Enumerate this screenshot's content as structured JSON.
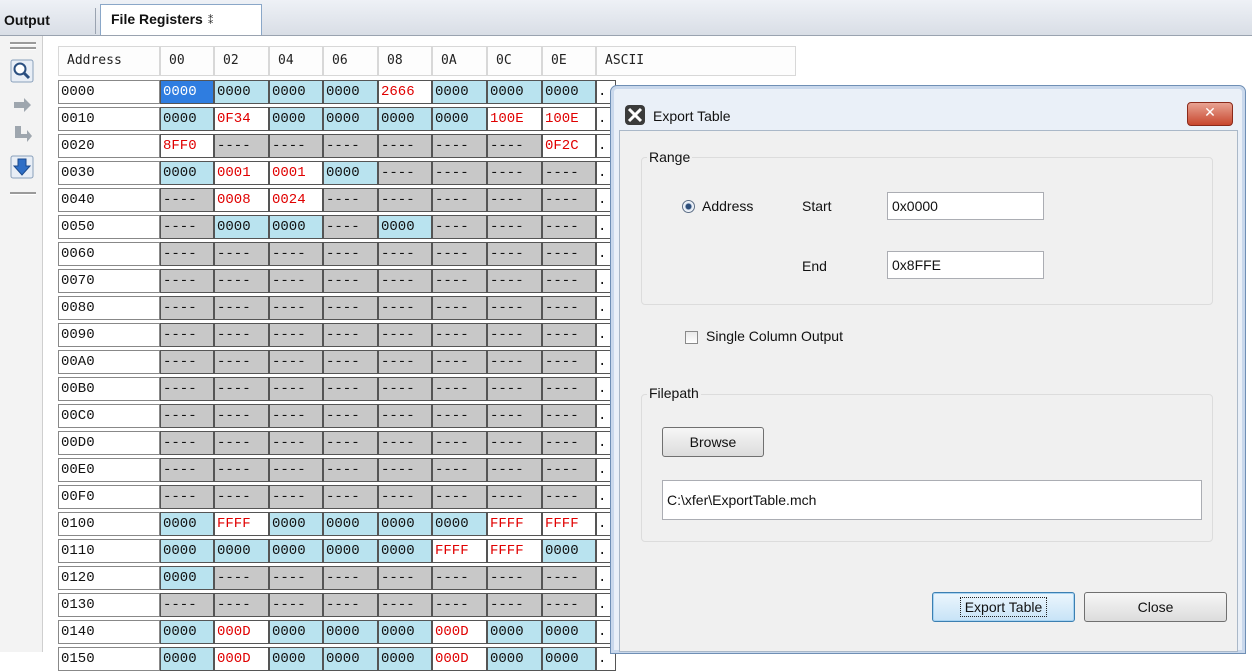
{
  "tabs": {
    "output": "Output",
    "file_registers": "File Registers",
    "close_glyph": "⁑"
  },
  "toolbar": [
    "zoom-search-icon",
    "step-over-icon",
    "step-back-icon",
    "download-arrow-icon"
  ],
  "table": {
    "headers": [
      "Address",
      "00",
      "02",
      "04",
      "06",
      "08",
      "0A",
      "0C",
      "0E",
      "ASCII"
    ],
    "rows": [
      {
        "addr": "0000",
        "cells": [
          [
            "0000",
            "sel"
          ],
          [
            "0000",
            "cyan"
          ],
          [
            "0000",
            "cyan"
          ],
          [
            "0000",
            "cyan"
          ],
          [
            "2666",
            "red"
          ],
          [
            "0000",
            "cyan"
          ],
          [
            "0000",
            "cyan"
          ],
          [
            "0000",
            "cyan"
          ]
        ]
      },
      {
        "addr": "0010",
        "cells": [
          [
            "0000",
            "cyan"
          ],
          [
            "0F34",
            "red"
          ],
          [
            "0000",
            "cyan"
          ],
          [
            "0000",
            "cyan"
          ],
          [
            "0000",
            "cyan"
          ],
          [
            "0000",
            "cyan"
          ],
          [
            "100E",
            "red"
          ],
          [
            "100E",
            "red"
          ]
        ]
      },
      {
        "addr": "0020",
        "cells": [
          [
            "8FF0",
            "red"
          ],
          [
            "----",
            "gray"
          ],
          [
            "----",
            "gray"
          ],
          [
            "----",
            "gray"
          ],
          [
            "----",
            "gray"
          ],
          [
            "----",
            "gray"
          ],
          [
            "----",
            "gray"
          ],
          [
            "0F2C",
            "red"
          ]
        ]
      },
      {
        "addr": "0030",
        "cells": [
          [
            "0000",
            "cyan"
          ],
          [
            "0001",
            "red"
          ],
          [
            "0001",
            "red"
          ],
          [
            "0000",
            "cyan"
          ],
          [
            "----",
            "gray"
          ],
          [
            "----",
            "gray"
          ],
          [
            "----",
            "gray"
          ],
          [
            "----",
            "gray"
          ]
        ]
      },
      {
        "addr": "0040",
        "cells": [
          [
            "----",
            "gray"
          ],
          [
            "0008",
            "red"
          ],
          [
            "0024",
            "red"
          ],
          [
            "----",
            "gray"
          ],
          [
            "----",
            "gray"
          ],
          [
            "----",
            "gray"
          ],
          [
            "----",
            "gray"
          ],
          [
            "----",
            "gray"
          ]
        ]
      },
      {
        "addr": "0050",
        "cells": [
          [
            "----",
            "gray"
          ],
          [
            "0000",
            "cyan"
          ],
          [
            "0000",
            "cyan"
          ],
          [
            "----",
            "gray"
          ],
          [
            "0000",
            "cyan"
          ],
          [
            "----",
            "gray"
          ],
          [
            "----",
            "gray"
          ],
          [
            "----",
            "gray"
          ]
        ]
      },
      {
        "addr": "0060",
        "cells": [
          [
            "----",
            "gray"
          ],
          [
            "----",
            "gray"
          ],
          [
            "----",
            "gray"
          ],
          [
            "----",
            "gray"
          ],
          [
            "----",
            "gray"
          ],
          [
            "----",
            "gray"
          ],
          [
            "----",
            "gray"
          ],
          [
            "----",
            "gray"
          ]
        ]
      },
      {
        "addr": "0070",
        "cells": [
          [
            "----",
            "gray"
          ],
          [
            "----",
            "gray"
          ],
          [
            "----",
            "gray"
          ],
          [
            "----",
            "gray"
          ],
          [
            "----",
            "gray"
          ],
          [
            "----",
            "gray"
          ],
          [
            "----",
            "gray"
          ],
          [
            "----",
            "gray"
          ]
        ]
      },
      {
        "addr": "0080",
        "cells": [
          [
            "----",
            "gray"
          ],
          [
            "----",
            "gray"
          ],
          [
            "----",
            "gray"
          ],
          [
            "----",
            "gray"
          ],
          [
            "----",
            "gray"
          ],
          [
            "----",
            "gray"
          ],
          [
            "----",
            "gray"
          ],
          [
            "----",
            "gray"
          ]
        ]
      },
      {
        "addr": "0090",
        "cells": [
          [
            "----",
            "gray"
          ],
          [
            "----",
            "gray"
          ],
          [
            "----",
            "gray"
          ],
          [
            "----",
            "gray"
          ],
          [
            "----",
            "gray"
          ],
          [
            "----",
            "gray"
          ],
          [
            "----",
            "gray"
          ],
          [
            "----",
            "gray"
          ]
        ]
      },
      {
        "addr": "00A0",
        "cells": [
          [
            "----",
            "gray"
          ],
          [
            "----",
            "gray"
          ],
          [
            "----",
            "gray"
          ],
          [
            "----",
            "gray"
          ],
          [
            "----",
            "gray"
          ],
          [
            "----",
            "gray"
          ],
          [
            "----",
            "gray"
          ],
          [
            "----",
            "gray"
          ]
        ]
      },
      {
        "addr": "00B0",
        "cells": [
          [
            "----",
            "gray"
          ],
          [
            "----",
            "gray"
          ],
          [
            "----",
            "gray"
          ],
          [
            "----",
            "gray"
          ],
          [
            "----",
            "gray"
          ],
          [
            "----",
            "gray"
          ],
          [
            "----",
            "gray"
          ],
          [
            "----",
            "gray"
          ]
        ]
      },
      {
        "addr": "00C0",
        "cells": [
          [
            "----",
            "gray"
          ],
          [
            "----",
            "gray"
          ],
          [
            "----",
            "gray"
          ],
          [
            "----",
            "gray"
          ],
          [
            "----",
            "gray"
          ],
          [
            "----",
            "gray"
          ],
          [
            "----",
            "gray"
          ],
          [
            "----",
            "gray"
          ]
        ]
      },
      {
        "addr": "00D0",
        "cells": [
          [
            "----",
            "gray"
          ],
          [
            "----",
            "gray"
          ],
          [
            "----",
            "gray"
          ],
          [
            "----",
            "gray"
          ],
          [
            "----",
            "gray"
          ],
          [
            "----",
            "gray"
          ],
          [
            "----",
            "gray"
          ],
          [
            "----",
            "gray"
          ]
        ]
      },
      {
        "addr": "00E0",
        "cells": [
          [
            "----",
            "gray"
          ],
          [
            "----",
            "gray"
          ],
          [
            "----",
            "gray"
          ],
          [
            "----",
            "gray"
          ],
          [
            "----",
            "gray"
          ],
          [
            "----",
            "gray"
          ],
          [
            "----",
            "gray"
          ],
          [
            "----",
            "gray"
          ]
        ]
      },
      {
        "addr": "00F0",
        "cells": [
          [
            "----",
            "gray"
          ],
          [
            "----",
            "gray"
          ],
          [
            "----",
            "gray"
          ],
          [
            "----",
            "gray"
          ],
          [
            "----",
            "gray"
          ],
          [
            "----",
            "gray"
          ],
          [
            "----",
            "gray"
          ],
          [
            "----",
            "gray"
          ]
        ]
      },
      {
        "addr": "0100",
        "cells": [
          [
            "0000",
            "cyan"
          ],
          [
            "FFFF",
            "red"
          ],
          [
            "0000",
            "cyan"
          ],
          [
            "0000",
            "cyan"
          ],
          [
            "0000",
            "cyan"
          ],
          [
            "0000",
            "cyan"
          ],
          [
            "FFFF",
            "red"
          ],
          [
            "FFFF",
            "red"
          ]
        ]
      },
      {
        "addr": "0110",
        "cells": [
          [
            "0000",
            "cyan"
          ],
          [
            "0000",
            "cyan"
          ],
          [
            "0000",
            "cyan"
          ],
          [
            "0000",
            "cyan"
          ],
          [
            "0000",
            "cyan"
          ],
          [
            "FFFF",
            "red"
          ],
          [
            "FFFF",
            "red"
          ],
          [
            "0000",
            "cyan"
          ]
        ]
      },
      {
        "addr": "0120",
        "cells": [
          [
            "0000",
            "cyan"
          ],
          [
            "----",
            "gray"
          ],
          [
            "----",
            "gray"
          ],
          [
            "----",
            "gray"
          ],
          [
            "----",
            "gray"
          ],
          [
            "----",
            "gray"
          ],
          [
            "----",
            "gray"
          ],
          [
            "----",
            "gray"
          ]
        ]
      },
      {
        "addr": "0130",
        "cells": [
          [
            "----",
            "gray"
          ],
          [
            "----",
            "gray"
          ],
          [
            "----",
            "gray"
          ],
          [
            "----",
            "gray"
          ],
          [
            "----",
            "gray"
          ],
          [
            "----",
            "gray"
          ],
          [
            "----",
            "gray"
          ],
          [
            "----",
            "gray"
          ]
        ]
      },
      {
        "addr": "0140",
        "cells": [
          [
            "0000",
            "cyan"
          ],
          [
            "000D",
            "red"
          ],
          [
            "0000",
            "cyan"
          ],
          [
            "0000",
            "cyan"
          ],
          [
            "0000",
            "cyan"
          ],
          [
            "000D",
            "red"
          ],
          [
            "0000",
            "cyan"
          ],
          [
            "0000",
            "cyan"
          ]
        ]
      },
      {
        "addr": "0150",
        "cells": [
          [
            "0000",
            "cyan"
          ],
          [
            "000D",
            "red"
          ],
          [
            "0000",
            "cyan"
          ],
          [
            "0000",
            "cyan"
          ],
          [
            "0000",
            "cyan"
          ],
          [
            "000D",
            "red"
          ],
          [
            "0000",
            "cyan"
          ],
          [
            "0000",
            "cyan"
          ]
        ]
      }
    ],
    "ascii_glyph": "."
  },
  "dialog": {
    "title": "Export Table",
    "close_glyph": "✕",
    "range_legend": "Range",
    "address_radio": "Address",
    "start_label": "Start",
    "start_value": "0x0000",
    "end_label": "End",
    "end_value": "0x8FFE",
    "single_column": "Single Column Output",
    "filepath_legend": "Filepath",
    "browse": "Browse",
    "filepath_value": "C:\\xfer\\ExportTable.mch",
    "export_button": "Export Table",
    "close_button": "Close"
  }
}
